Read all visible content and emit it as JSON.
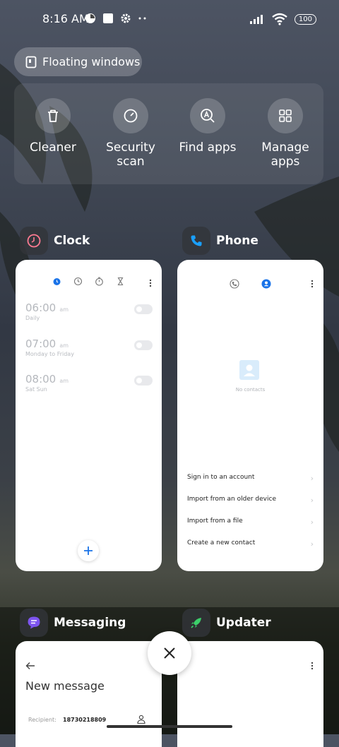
{
  "status_bar": {
    "time": "8:16 AM",
    "battery": "100"
  },
  "floating_windows": {
    "label": "Floating windows"
  },
  "tools": [
    {
      "label": "Cleaner",
      "icon": "trash-icon"
    },
    {
      "label": "Security\nscan",
      "icon": "security-scan-icon"
    },
    {
      "label": "Find apps",
      "icon": "find-apps-icon"
    },
    {
      "label": "Manage\napps",
      "icon": "grid-icon"
    }
  ],
  "apps": {
    "clock": {
      "title": "Clock",
      "alarms": [
        {
          "time": "06:00",
          "ampm": "am",
          "repeat": "Daily"
        },
        {
          "time": "07:00",
          "ampm": "am",
          "repeat": "Monday to Friday"
        },
        {
          "time": "08:00",
          "ampm": "am",
          "repeat": "Sat Sun"
        }
      ]
    },
    "phone": {
      "title": "Phone",
      "empty_text": "No contacts",
      "options": [
        "Sign in to an account",
        "Import from an older device",
        "Import from a file",
        "Create a new contact"
      ]
    },
    "messaging": {
      "title": "Messaging",
      "heading": "New message",
      "recipient_label": "Recipient:",
      "recipient_value": "18730218809"
    },
    "updater": {
      "title": "Updater"
    }
  },
  "colors": {
    "accent": "#1a73e8",
    "clock_icon": "#ff7b92",
    "phone_icon": "#1aa0ff",
    "messaging_icon": "#7d54f0",
    "updater_icon": "#3ccf6a"
  }
}
